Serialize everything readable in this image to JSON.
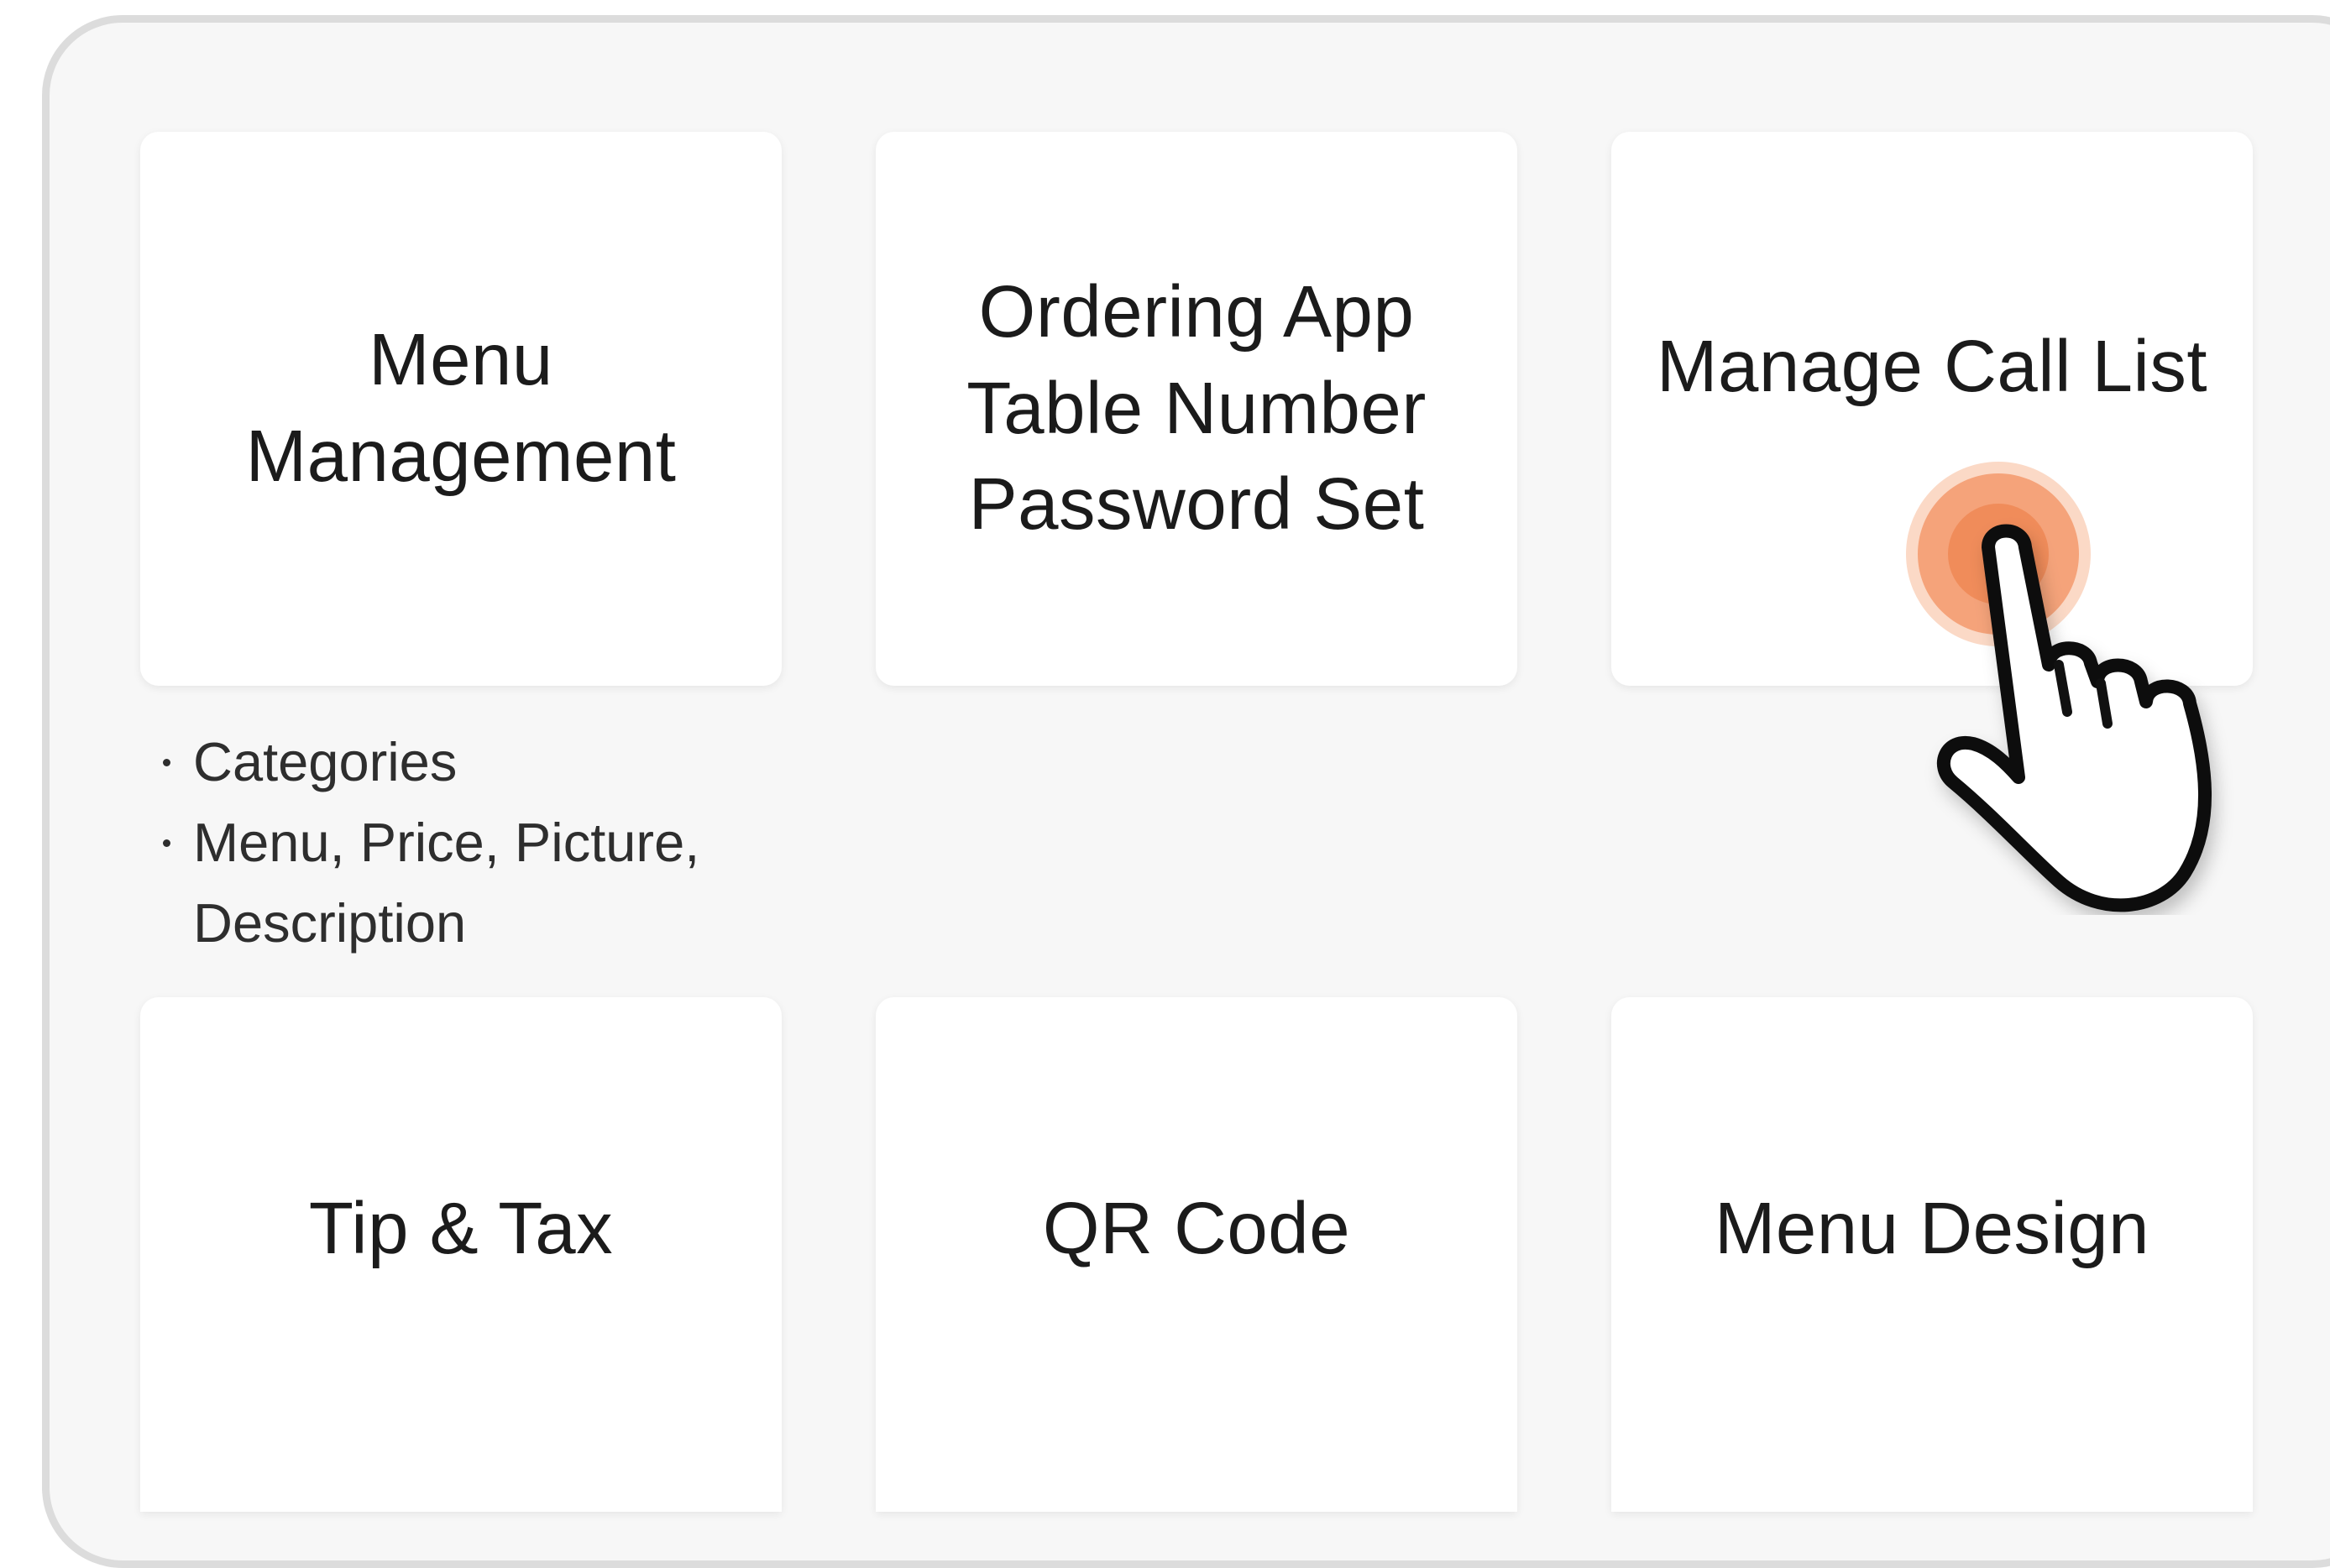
{
  "cards": {
    "menu_management": "Menu\nManagement",
    "ordering_app": "Ordering App\nTable Number\nPassword Set",
    "manage_call_list": "Manage Call List",
    "tip_tax": "Tip & Tax",
    "qr_code": "QR Code",
    "menu_design": "Menu Design"
  },
  "menu_management_details": [
    "Categories",
    "Menu, Price, Picture, Description"
  ],
  "pointer": {
    "icon": "tap-hand-icon",
    "accent_color": "#f5a37a"
  }
}
